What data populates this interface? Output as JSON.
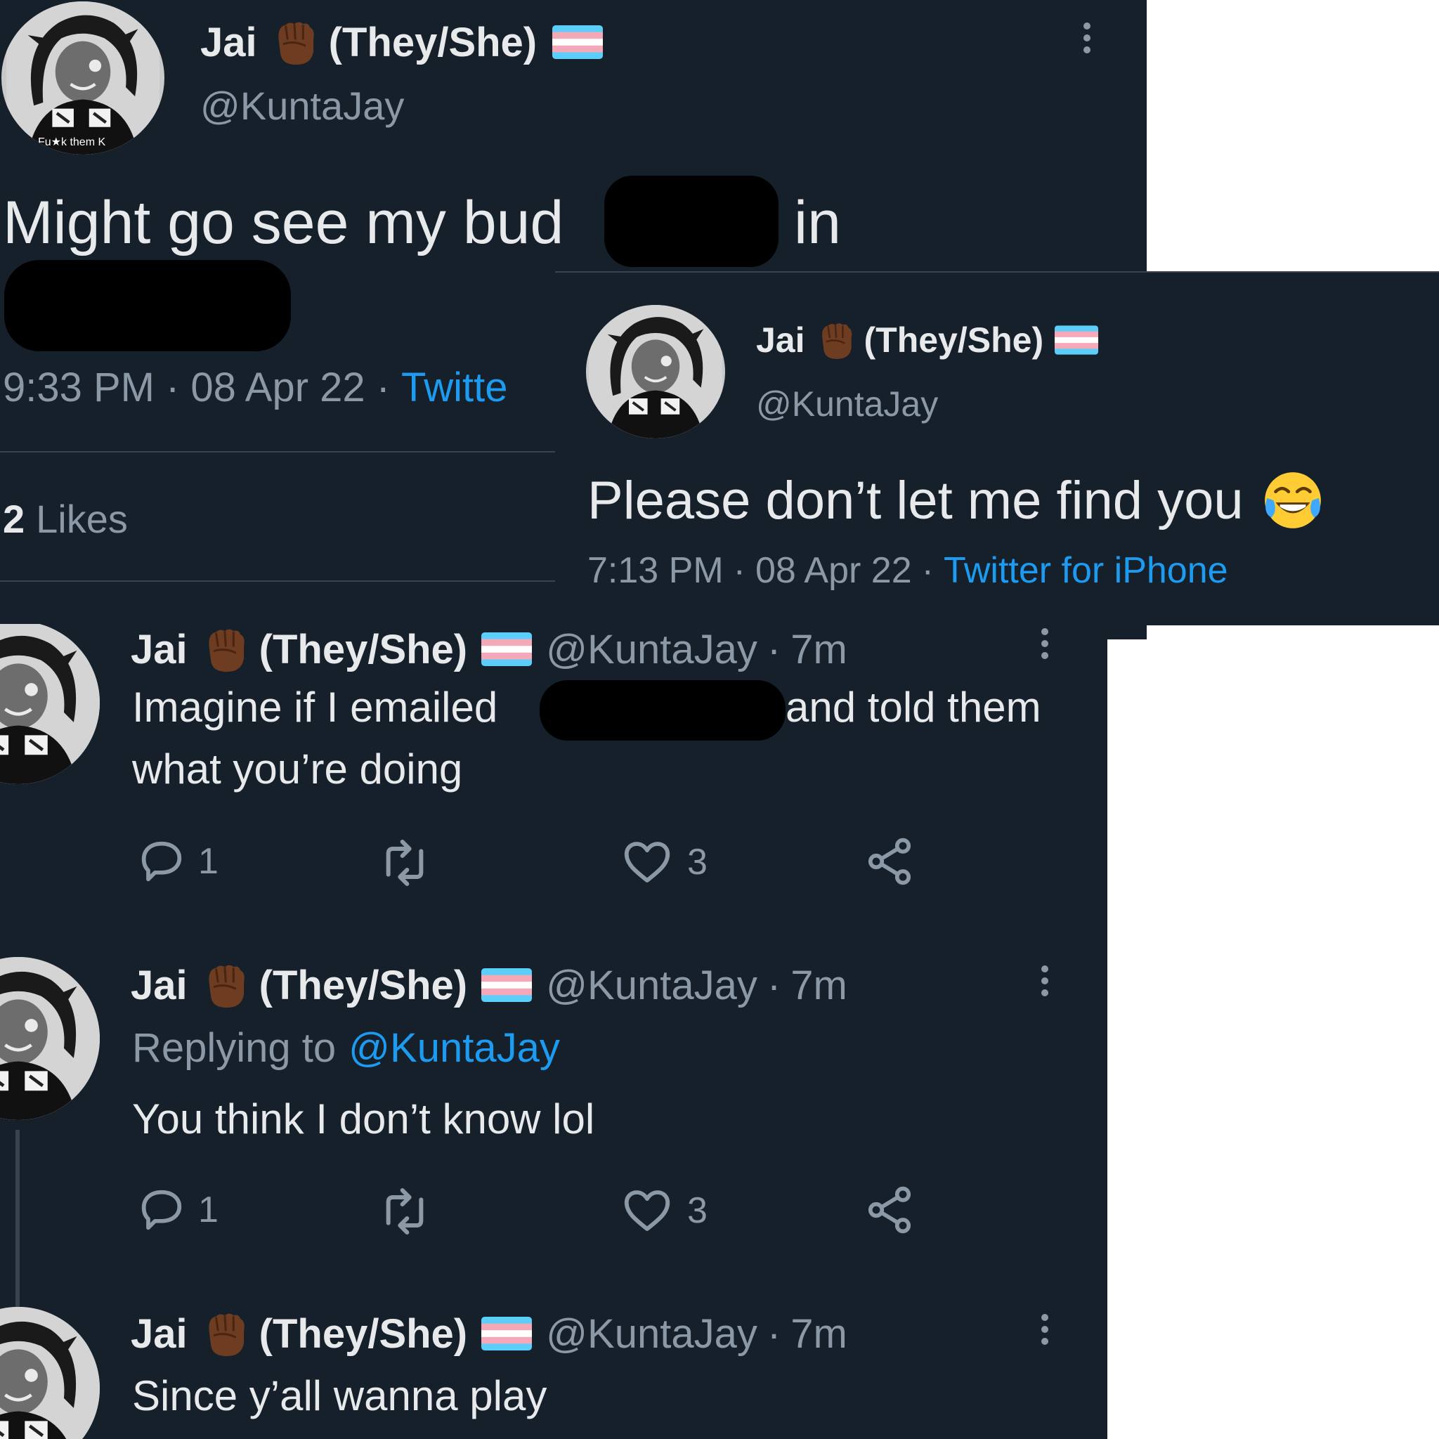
{
  "author": {
    "display_name": "Jai",
    "pronouns": "(They/She)",
    "handle": "@KuntaJay",
    "fist_emoji": "raised-fist-dark-skin",
    "flag_emoji": "transgender-flag",
    "avatar_caption": "Fu★k them K"
  },
  "main_tweet": {
    "text_line1_a": "Might go see my bud",
    "text_line1_b": "in",
    "time": "9:33 PM",
    "date": "08 Apr 22",
    "separator": "·",
    "source": "Twitte",
    "likes_count": "2",
    "likes_label": "Likes"
  },
  "quoted_tweet": {
    "text": "Please don’t let me find you",
    "emoji": "face-with-tears-of-joy",
    "time": "7:13 PM",
    "date": "08 Apr 22",
    "source": "Twitter for iPhone"
  },
  "replies": [
    {
      "age": "7m",
      "text_a": "Imagine if I emailed",
      "text_b": "and told them",
      "text_line2": "what you’re doing",
      "reply_count": "1",
      "like_count": "3"
    },
    {
      "age": "7m",
      "replying_prefix": "Replying to",
      "replying_handle": "@KuntaJay",
      "text": "You think I don’t know lol",
      "reply_count": "1",
      "like_count": "3"
    },
    {
      "age": "7m",
      "text": "Since y’all wanna play"
    }
  ],
  "icons": [
    "reply-icon",
    "retweet-icon",
    "like-icon",
    "share-icon",
    "more-icon"
  ],
  "colors": {
    "background": "#15202b",
    "text": "#e7e9ea",
    "muted": "#8b98a5",
    "link": "#1d9bf0",
    "divider": "#38444d"
  }
}
